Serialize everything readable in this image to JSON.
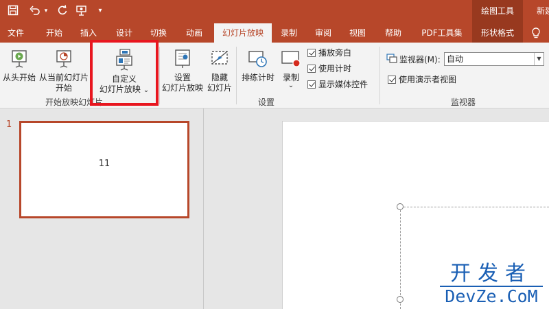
{
  "title_bar": {
    "contextual_tools_label": "绘图工具",
    "right_text": "新建"
  },
  "tabs": [
    {
      "label": "文件"
    },
    {
      "label": "开始"
    },
    {
      "label": "插入"
    },
    {
      "label": "设计"
    },
    {
      "label": "切换"
    },
    {
      "label": "动画"
    },
    {
      "label": "幻灯片放映",
      "active": true
    },
    {
      "label": "录制"
    },
    {
      "label": "审阅"
    },
    {
      "label": "视图"
    },
    {
      "label": "帮助"
    },
    {
      "label": "PDF工具集"
    },
    {
      "label": "形状格式",
      "contextual": true
    }
  ],
  "ribbon": {
    "start_group": {
      "from_beginning": "从头开始",
      "from_current_line1": "从当前幻灯片",
      "from_current_line2": "开始",
      "custom_line1": "自定义",
      "custom_line2": "幻灯片放映",
      "custom_arrow": "⌄",
      "label": "开始放映幻灯片"
    },
    "setup_group": {
      "setup_line1": "设置",
      "setup_line2": "幻灯片放映",
      "hide_line1": "隐藏",
      "hide_line2": "幻灯片",
      "rehearse": "排练计时",
      "record": "录制",
      "record_arrow": "⌄",
      "play_narrations": "播放旁白",
      "use_timings": "使用计时",
      "show_media_controls": "显示媒体控件",
      "label": "设置"
    },
    "monitors_group": {
      "monitor_label": "监视器(M):",
      "monitor_value": "自动",
      "presenter_view": "使用演示者视图",
      "label": "监视器"
    }
  },
  "slides_pane": {
    "slide_number": "1",
    "thumbnail_text": "11"
  },
  "watermark": {
    "cn": "开发者",
    "en": "DevZe.CoM"
  },
  "colors": {
    "accent": "#b7472a",
    "contextual": "#98391f",
    "highlight": "#e8161f",
    "watermark": "#1a5fb4"
  },
  "icons": [
    "save-icon",
    "undo-icon",
    "redo-icon",
    "present-from-start-icon",
    "customize-qat-icon",
    "lightbulb-icon"
  ]
}
